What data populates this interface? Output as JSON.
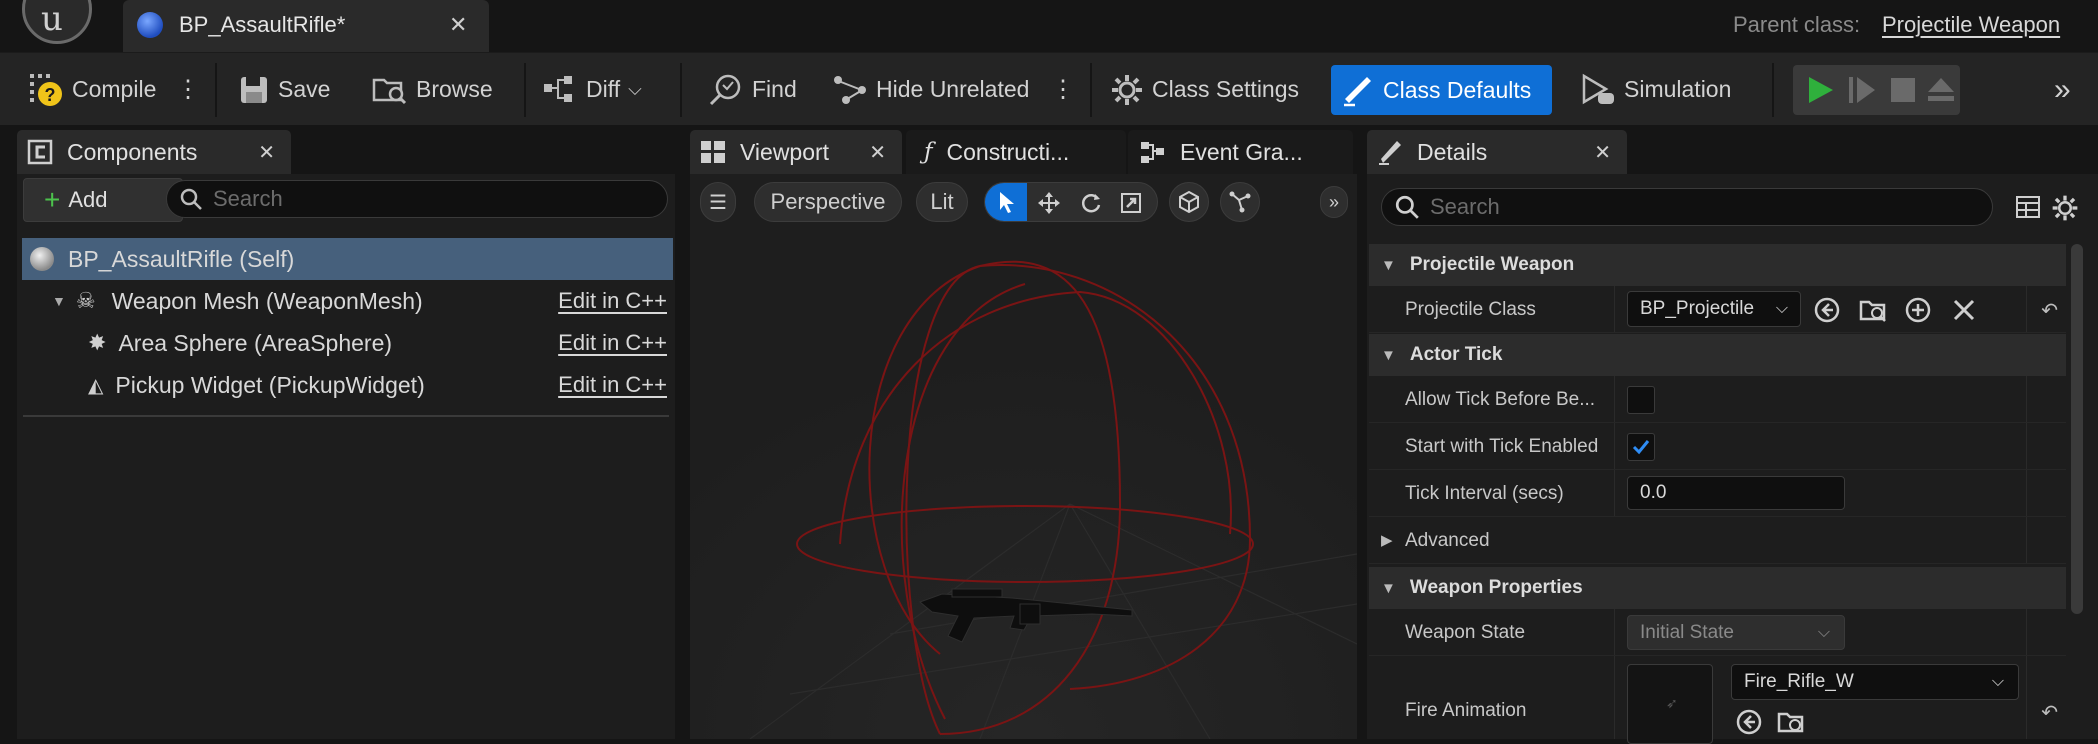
{
  "titlebar": {
    "logo_glyph": "u",
    "document_tab": "BP_AssaultRifle*",
    "parent_class_label": "Parent class:",
    "parent_class_value": "Projectile Weapon"
  },
  "toolbar": {
    "compile": "Compile",
    "save": "Save",
    "browse": "Browse",
    "diff": "Diff",
    "find": "Find",
    "hide_unrelated": "Hide Unrelated",
    "class_settings": "Class Settings",
    "class_defaults": "Class Defaults",
    "simulation": "Simulation",
    "accent_color": "#0f6fd6",
    "play_color": "#2fb03c"
  },
  "components": {
    "tab": "Components",
    "add": "Add",
    "search_placeholder": "Search",
    "tree": [
      {
        "label": "BP_AssaultRifle (Self)",
        "edit": ""
      },
      {
        "label": "Weapon Mesh (WeaponMesh)",
        "edit": "Edit in C++"
      },
      {
        "label": "Area Sphere (AreaSphere)",
        "edit": "Edit in C++"
      },
      {
        "label": "Pickup Widget (PickupWidget)",
        "edit": "Edit in C++"
      }
    ]
  },
  "viewport": {
    "tabs": [
      "Viewport",
      "Constructi...",
      "Event Gra..."
    ],
    "perspective": "Perspective",
    "lit": "Lit"
  },
  "details": {
    "tab": "Details",
    "search_placeholder": "Search",
    "categories": [
      "Projectile Weapon",
      "Actor Tick",
      "Weapon Properties"
    ],
    "projectile_class_label": "Projectile Class",
    "projectile_class_value": "BP_Projectile",
    "allow_tick_label": "Allow Tick Before Be...",
    "start_tick_label": "Start with Tick Enabled",
    "tick_interval_label": "Tick Interval (secs)",
    "tick_interval_value": "0.0",
    "advanced_label": "Advanced",
    "weapon_state_label": "Weapon State",
    "weapon_state_value": "Initial State",
    "fire_animation_label": "Fire Animation",
    "fire_animation_value": "Fire_Rifle_W",
    "allow_tick_checked": false,
    "start_tick_checked": true
  }
}
